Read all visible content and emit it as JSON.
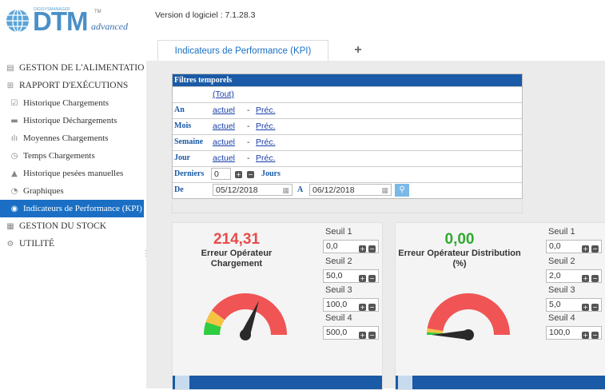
{
  "header": {
    "logo_small": "DIGISYSMANAGER",
    "logo_main": "DTM",
    "logo_sub": "advanced",
    "logo_tm": "TM",
    "version": "Version d logiciel : 7.1.28.3"
  },
  "tabs": [
    {
      "label": "Indicateurs de Performance (KPI)"
    },
    {
      "label": "+"
    }
  ],
  "sidebar": {
    "items": [
      {
        "label": "GESTION DE L'ALIMENTATION",
        "icon": "feed-icon",
        "glyph": "▤"
      },
      {
        "label": "RAPPORT D'EXÉCUTIONS",
        "icon": "report-icon",
        "glyph": "⊞"
      },
      {
        "label": "Historique Chargements",
        "icon": "checkbox-icon",
        "glyph": "☑"
      },
      {
        "label": "Historique Déchargements",
        "icon": "truck-icon",
        "glyph": "▬"
      },
      {
        "label": "Moyennes Chargements",
        "icon": "bars-icon",
        "glyph": "ılı"
      },
      {
        "label": "Temps Chargements",
        "icon": "timer-icon",
        "glyph": "◷"
      },
      {
        "label": "Historique pesées manuelles",
        "icon": "scale-icon",
        "glyph": "▲"
      },
      {
        "label": "Graphiques",
        "icon": "pie-chart-icon",
        "glyph": "◔"
      },
      {
        "label": "Indicateurs de Performance (KPI)",
        "icon": "dashboard-icon",
        "glyph": "◉"
      },
      {
        "label": "GESTION DU STOCK",
        "icon": "stock-icon",
        "glyph": "▦"
      },
      {
        "label": "UTILITÉ",
        "icon": "gear-icon",
        "glyph": "⚙"
      }
    ]
  },
  "filters": {
    "title": "Filtres temporels",
    "tout": "(Tout)",
    "rows": [
      {
        "label": "An",
        "actuel": "actuel",
        "prec": "Préc."
      },
      {
        "label": "Mois",
        "actuel": "actuel",
        "prec": "Préc."
      },
      {
        "label": "Semaine",
        "actuel": "actuel",
        "prec": "Préc."
      },
      {
        "label": "Jour",
        "actuel": "actuel",
        "prec": "Préc."
      }
    ],
    "dash": "-",
    "derniers_label": "Derniers",
    "derniers_value": "0",
    "jours_label": "Jours",
    "de_label": "De",
    "date_from": "05/12/2018",
    "a_label": "A",
    "date_to": "06/12/2018"
  },
  "cards": [
    {
      "value": "214,31",
      "value_color": "#e84b4b",
      "label": "Erreur Opérateur Chargement",
      "needle_fraction": 0.62,
      "seuils": [
        {
          "label": "Seuil 1",
          "value": "0,0"
        },
        {
          "label": "Seuil 2",
          "value": "50,0"
        },
        {
          "label": "Seuil 3",
          "value": "100,0"
        },
        {
          "label": "Seuil 4",
          "value": "500,0"
        }
      ]
    },
    {
      "value": "0,00",
      "value_color": "#2eaa2e",
      "label": "Erreur Opérateur Distribution (%)",
      "needle_fraction": 0.0,
      "seuils": [
        {
          "label": "Seuil 1",
          "value": "0,0"
        },
        {
          "label": "Seuil 2",
          "value": "2,0"
        },
        {
          "label": "Seuil 3",
          "value": "5,0"
        },
        {
          "label": "Seuil 4",
          "value": "100,0"
        }
      ]
    }
  ],
  "colors": {
    "accent": "#1a6fc4",
    "header_blue": "#1a5aa6",
    "gauge_red": "#f05454",
    "gauge_yellow": "#f5c243",
    "gauge_green": "#2ecc40"
  }
}
